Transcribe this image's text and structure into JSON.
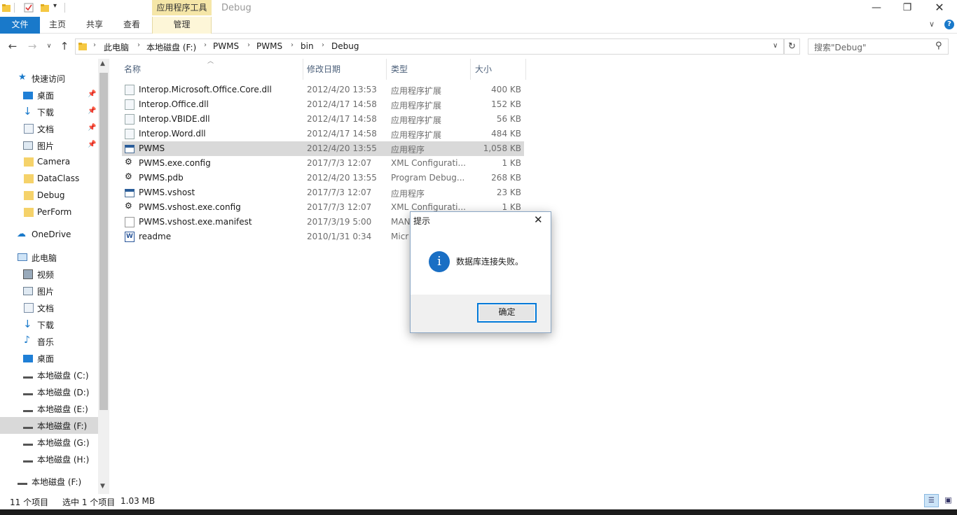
{
  "window": {
    "title": "Debug",
    "context_group": "应用程序工具"
  },
  "ribbon": {
    "tabs": [
      "文件",
      "主页",
      "共享",
      "查看"
    ],
    "manage_tab": "管理"
  },
  "address": {
    "crumbs": [
      "此电脑",
      "本地磁盘 (F:)",
      "PWMS",
      "PWMS",
      "bin",
      "Debug"
    ]
  },
  "search": {
    "placeholder": "搜索\"Debug\""
  },
  "nav": {
    "quick_access": "快速访问",
    "pinned": [
      "桌面",
      "下载",
      "文档",
      "图片"
    ],
    "folders": [
      "Camera",
      "DataClass",
      "Debug",
      "PerForm"
    ],
    "onedrive": "OneDrive",
    "this_pc": "此电脑",
    "pc_items": [
      "视频",
      "图片",
      "文档",
      "下载",
      "音乐",
      "桌面",
      "本地磁盘 (C:)",
      "本地磁盘 (D:)",
      "本地磁盘 (E:)",
      "本地磁盘 (F:)",
      "本地磁盘 (G:)",
      "本地磁盘 (H:)"
    ],
    "drive_bottom": "本地磁盘 (F:)"
  },
  "columns": {
    "name": "名称",
    "date": "修改日期",
    "type": "类型",
    "size": "大小"
  },
  "files": [
    {
      "name": "Interop.Microsoft.Office.Core.dll",
      "date": "2012/4/20 13:53",
      "type": "应用程序扩展",
      "size": "400 KB"
    },
    {
      "name": "Interop.Office.dll",
      "date": "2012/4/17 14:58",
      "type": "应用程序扩展",
      "size": "152 KB"
    },
    {
      "name": "Interop.VBIDE.dll",
      "date": "2012/4/17 14:58",
      "type": "应用程序扩展",
      "size": "56 KB"
    },
    {
      "name": "Interop.Word.dll",
      "date": "2012/4/17 14:58",
      "type": "应用程序扩展",
      "size": "484 KB"
    },
    {
      "name": "PWMS",
      "date": "2012/4/20 13:55",
      "type": "应用程序",
      "size": "1,058 KB"
    },
    {
      "name": "PWMS.exe.config",
      "date": "2017/7/3 12:07",
      "type": "XML Configurati...",
      "size": "1 KB"
    },
    {
      "name": "PWMS.pdb",
      "date": "2012/4/20 13:55",
      "type": "Program Debug...",
      "size": "268 KB"
    },
    {
      "name": "PWMS.vshost",
      "date": "2017/7/3 12:07",
      "type": "应用程序",
      "size": "23 KB"
    },
    {
      "name": "PWMS.vshost.exe.config",
      "date": "2017/7/3 12:07",
      "type": "XML Configurati...",
      "size": "1 KB"
    },
    {
      "name": "PWMS.vshost.exe.manifest",
      "date": "2017/3/19 5:00",
      "type": "MAN",
      "size": ""
    },
    {
      "name": "readme",
      "date": "2010/1/31 0:34",
      "type": "Micr",
      "size": ""
    }
  ],
  "dialog": {
    "title": "提示",
    "message": "数据库连接失败。",
    "ok": "确定"
  },
  "status": {
    "count": "11 个项目",
    "selected": "选中 1 个项目",
    "size": "1.03 MB"
  }
}
